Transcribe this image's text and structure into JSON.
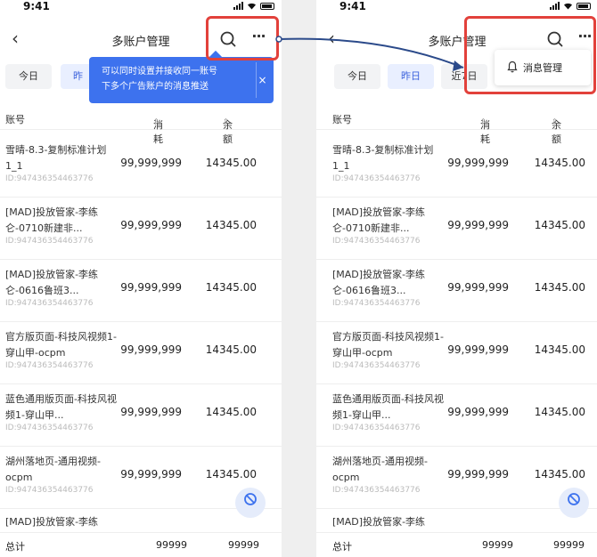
{
  "colors": {
    "accent": "#3d72ee",
    "highlight": "#e2413b",
    "active_tab_bg": "#e9efff",
    "active_tab_text": "#3d63dd"
  },
  "status": {
    "time": "9:41"
  },
  "nav": {
    "title": "多账户管理"
  },
  "tabs": [
    "今日",
    "昨日",
    "近7日"
  ],
  "left_tabs_visible": [
    "今日",
    "昨"
  ],
  "right_tabs_visible": [
    "今日",
    "昨日",
    "近7日"
  ],
  "tooltip": {
    "line1": "可以同时设置并接收同一账号",
    "line2": "下多个广告账户的消息推送",
    "close": "×"
  },
  "dropdown": {
    "item": "消息管理"
  },
  "table": {
    "headers": {
      "account": "账号",
      "cost": "消耗",
      "balance": "余额",
      "sort_icon": "⇕"
    },
    "rows": [
      {
        "name": "雪晴-8.3-复制标准计划1_1",
        "id": "ID:947436354463776",
        "cost": "99,999,999",
        "balance": "14345.00"
      },
      {
        "name": "[MAD]投放管家-李练仑-0710新建非...",
        "id": "ID:947436354463776",
        "cost": "99,999,999",
        "balance": "14345.00"
      },
      {
        "name": "[MAD]投放管家-李练仑-0616鲁班3...",
        "id": "ID:947436354463776",
        "cost": "99,999,999",
        "balance": "14345.00"
      },
      {
        "name": "官方版页面-科技风视频1-穿山甲-ocpm",
        "id": "ID:947436354463776",
        "cost": "99,999,999",
        "balance": "14345.00"
      },
      {
        "name": "蓝色通用版页面-科技风视频1-穿山甲...",
        "id": "ID:947436354463776",
        "cost": "99,999,999",
        "balance": "14345.00"
      },
      {
        "name": "湖州落地页-通用视频-ocpm",
        "id": "ID:947436354463776",
        "cost": "99,999,999",
        "balance": "14345.00"
      }
    ],
    "partial_row": "[MAD]投放管家-李练",
    "total": {
      "label": "总计",
      "cost": "99999",
      "balance": "99999"
    }
  },
  "icons": [
    "back-arrow-icon",
    "search-icon",
    "more-icon",
    "close-icon",
    "bell-icon",
    "refresh-float-icon",
    "signal-icon",
    "wifi-icon",
    "battery-icon"
  ]
}
